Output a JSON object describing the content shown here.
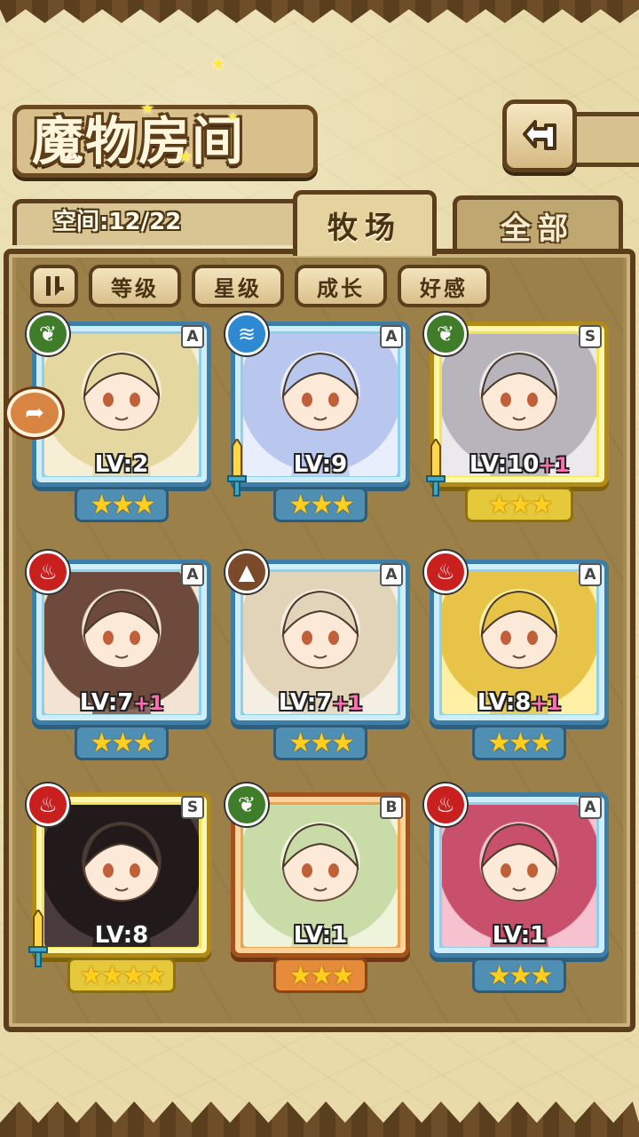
{
  "header": {
    "title": "魔物房间",
    "back_icon": "back-arrow-icon"
  },
  "space": {
    "label": "空间:12/22"
  },
  "tabs": [
    {
      "label": "牧场",
      "active": true
    },
    {
      "label": "全部",
      "active": false
    }
  ],
  "filters": [
    {
      "label": "等级"
    },
    {
      "label": "星级"
    },
    {
      "label": "成长"
    },
    {
      "label": "好感"
    }
  ],
  "sort_icon": "sort-toggle-icon",
  "monsters": [
    {
      "element": "grass",
      "element_glyph": "❦",
      "rank": "A",
      "frame": "blue",
      "level": "LV:2",
      "bonus": "",
      "stars": "★★★",
      "equipped": false
    },
    {
      "element": "water",
      "element_glyph": "≋",
      "rank": "A",
      "frame": "blue",
      "level": "LV:9",
      "bonus": "",
      "stars": "★★★",
      "equipped": true
    },
    {
      "element": "grass",
      "element_glyph": "❦",
      "rank": "S",
      "frame": "gold",
      "level": "LV:10",
      "bonus": "+1",
      "stars": "★★★",
      "equipped": true
    },
    {
      "element": "fire",
      "element_glyph": "♨",
      "rank": "A",
      "frame": "blue",
      "level": "LV:7",
      "bonus": "+1",
      "stars": "★★★",
      "equipped": false
    },
    {
      "element": "earth",
      "element_glyph": "▲",
      "rank": "A",
      "frame": "blue",
      "level": "LV:7",
      "bonus": "+1",
      "stars": "★★★",
      "equipped": false
    },
    {
      "element": "fire",
      "element_glyph": "♨",
      "rank": "A",
      "frame": "blue",
      "level": "LV:8",
      "bonus": "+1",
      "stars": "★★★",
      "equipped": false
    },
    {
      "element": "fire",
      "element_glyph": "♨",
      "rank": "S",
      "frame": "gold",
      "level": "LV:8",
      "bonus": "",
      "stars": "★★★★",
      "equipped": true
    },
    {
      "element": "grass",
      "element_glyph": "❦",
      "rank": "B",
      "frame": "bronze",
      "level": "LV:1",
      "bonus": "",
      "stars": "★★★",
      "equipped": false
    },
    {
      "element": "fire",
      "element_glyph": "♨",
      "rank": "A",
      "frame": "blue",
      "level": "LV:1",
      "bonus": "",
      "stars": "★★★",
      "equipped": false
    }
  ],
  "colors": {
    "parchment": "#e8dba9",
    "wood_dark": "#5b3f1c",
    "panel": "#9c8049"
  }
}
